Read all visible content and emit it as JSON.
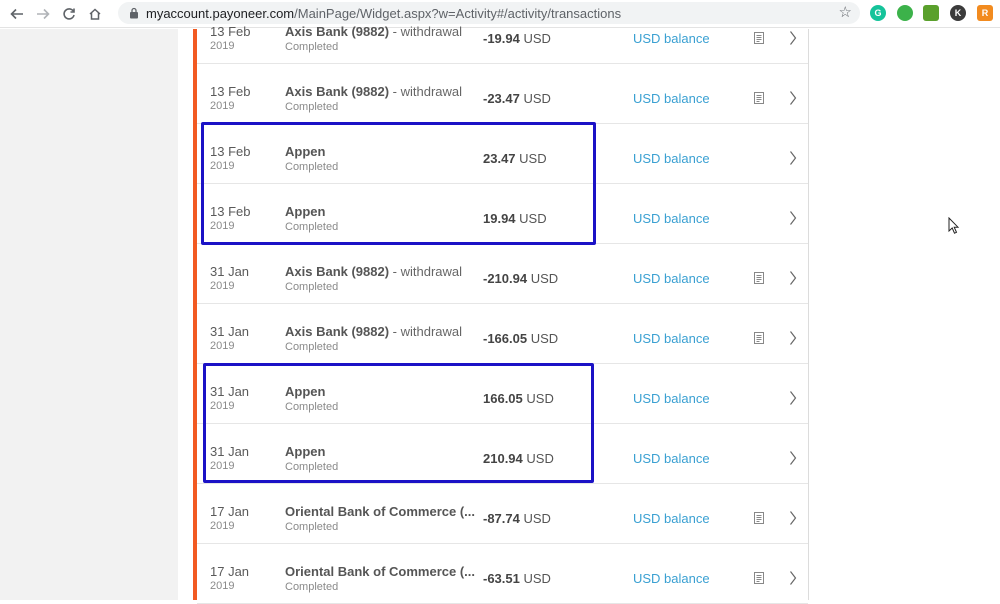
{
  "browser": {
    "url_domain": "myaccount.payoneer.com",
    "url_path": "/MainPage/Widget.aspx?w=Activity#/activity/transactions",
    "extensions": [
      {
        "name": "grammarly-icon",
        "letter": "G",
        "color": "#15c39a"
      },
      {
        "name": "thumb-extension-icon",
        "letter": "",
        "color": "#3cb24a"
      },
      {
        "name": "download-extension-icon",
        "letter": "",
        "color": "#5aa02c"
      },
      {
        "name": "k-extension-icon",
        "letter": "K",
        "color": "#3b3b3b"
      },
      {
        "name": "r-extension-icon",
        "letter": "R",
        "color": "#f28b1f"
      }
    ]
  },
  "transactions": [
    {
      "day": "13 Feb",
      "year": "2019",
      "payee": "Axis Bank (9882)",
      "suffix": " - withdrawal",
      "status": "Completed",
      "amount": "-19.94",
      "currency": "USD",
      "balance": "USD balance",
      "receipt": true
    },
    {
      "day": "13 Feb",
      "year": "2019",
      "payee": "Axis Bank (9882)",
      "suffix": " - withdrawal",
      "status": "Completed",
      "amount": "-23.47",
      "currency": "USD",
      "balance": "USD balance",
      "receipt": true
    },
    {
      "day": "13 Feb",
      "year": "2019",
      "payee": "Appen",
      "suffix": "",
      "status": "Completed",
      "amount": "23.47",
      "currency": "USD",
      "balance": "USD balance",
      "receipt": false
    },
    {
      "day": "13 Feb",
      "year": "2019",
      "payee": "Appen",
      "suffix": "",
      "status": "Completed",
      "amount": "19.94",
      "currency": "USD",
      "balance": "USD balance",
      "receipt": false
    },
    {
      "day": "31 Jan",
      "year": "2019",
      "payee": "Axis Bank (9882)",
      "suffix": " - withdrawal",
      "status": "Completed",
      "amount": "-210.94",
      "currency": "USD",
      "balance": "USD balance",
      "receipt": true
    },
    {
      "day": "31 Jan",
      "year": "2019",
      "payee": "Axis Bank (9882)",
      "suffix": " - withdrawal",
      "status": "Completed",
      "amount": "-166.05",
      "currency": "USD",
      "balance": "USD balance",
      "receipt": true
    },
    {
      "day": "31 Jan",
      "year": "2019",
      "payee": "Appen",
      "suffix": "",
      "status": "Completed",
      "amount": "166.05",
      "currency": "USD",
      "balance": "USD balance",
      "receipt": false
    },
    {
      "day": "31 Jan",
      "year": "2019",
      "payee": "Appen",
      "suffix": "",
      "status": "Completed",
      "amount": "210.94",
      "currency": "USD",
      "balance": "USD balance",
      "receipt": false
    },
    {
      "day": "17 Jan",
      "year": "2019",
      "payee": "Oriental Bank of Commerce (...",
      "suffix": "",
      "status": "Completed",
      "amount": "-87.74",
      "currency": "USD",
      "balance": "USD balance",
      "receipt": true
    },
    {
      "day": "17 Jan",
      "year": "2019",
      "payee": "Oriental Bank of Commerce (...",
      "suffix": "",
      "status": "Completed",
      "amount": "-63.51",
      "currency": "USD",
      "balance": "USD balance",
      "receipt": true
    }
  ],
  "colors": {
    "accent": "#f25a22",
    "link": "#3aa0d2",
    "highlight": "#1b12c6"
  }
}
